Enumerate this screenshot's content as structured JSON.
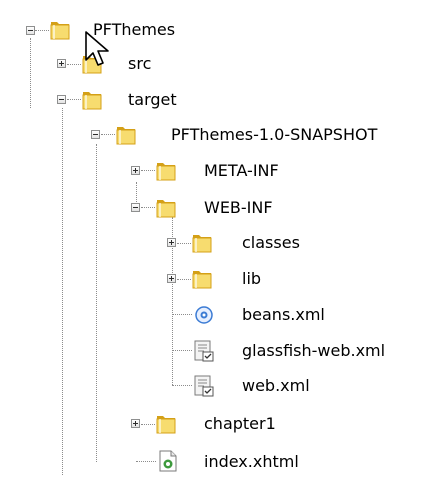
{
  "tree": {
    "nodes": [
      {
        "id": "pfthemes",
        "label": "PFThemes",
        "type": "folder",
        "state": "expanded",
        "depth": 0
      },
      {
        "id": "src",
        "label": "src",
        "type": "folder",
        "state": "collapsed",
        "depth": 1
      },
      {
        "id": "target",
        "label": "target",
        "type": "folder",
        "state": "expanded",
        "depth": 1
      },
      {
        "id": "pfthemes-snapshot",
        "label": "PFThemes-1.0-SNAPSHOT",
        "type": "folder",
        "state": "expanded",
        "depth": 2
      },
      {
        "id": "meta-inf",
        "label": "META-INF",
        "type": "folder",
        "state": "collapsed",
        "depth": 3
      },
      {
        "id": "web-inf",
        "label": "WEB-INF",
        "type": "folder",
        "state": "expanded",
        "depth": 3
      },
      {
        "id": "classes",
        "label": "classes",
        "type": "folder",
        "state": "collapsed",
        "depth": 4
      },
      {
        "id": "lib",
        "label": "lib",
        "type": "folder",
        "state": "collapsed",
        "depth": 4
      },
      {
        "id": "beans-xml",
        "label": "beans.xml",
        "type": "beans-file",
        "state": "leaf",
        "depth": 4
      },
      {
        "id": "glassfish-web-xml",
        "label": "glassfish-web.xml",
        "type": "config-file",
        "state": "leaf",
        "depth": 4
      },
      {
        "id": "web-xml",
        "label": "web.xml",
        "type": "config-file",
        "state": "leaf",
        "depth": 4
      },
      {
        "id": "chapter1",
        "label": "chapter1",
        "type": "folder",
        "state": "collapsed",
        "depth": 3
      },
      {
        "id": "index-xhtml",
        "label": "index.xhtml",
        "type": "web-page-file",
        "state": "leaf",
        "depth": 3
      }
    ]
  },
  "icons": {
    "folder": "folder-icon",
    "beans-file": "beans-xml-icon",
    "config-file": "xml-config-icon",
    "web-page-file": "xhtml-file-icon",
    "cursor": "mouse-pointer-icon"
  },
  "colors": {
    "folder_light": "#f7dc6f",
    "folder_dark": "#d4a017",
    "guide_line": "#8c8c8c",
    "beans_blue": "#3b7bd4",
    "xhtml_green": "#3d9a3d"
  }
}
